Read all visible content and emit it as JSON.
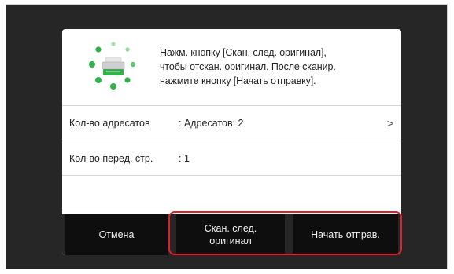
{
  "message": {
    "line1": "Нажм. кнопку [Скан. след. оригинал],",
    "line2": "чтобы отскан. оригинал. После сканир.",
    "line3": "нажмите кнопку [Начать отправку]."
  },
  "rows": {
    "recipients": {
      "label": "Кол-во адресатов",
      "value": ": Адресатов: 2",
      "chevron": ">"
    },
    "pages": {
      "label": "Кол-во перед. стр.",
      "value": ": 1"
    }
  },
  "buttons": {
    "cancel": "Отмена",
    "scan_next_line1": "Скан. след.",
    "scan_next_line2": "оригинал",
    "start_send": "Начать отправ."
  },
  "colors": {
    "accent_green": "#2fb34a",
    "highlight_red": "#e0202a",
    "button_bg": "#0e0e0e"
  },
  "icons": [
    "scanning-progress-icon",
    "chevron-right-icon"
  ]
}
